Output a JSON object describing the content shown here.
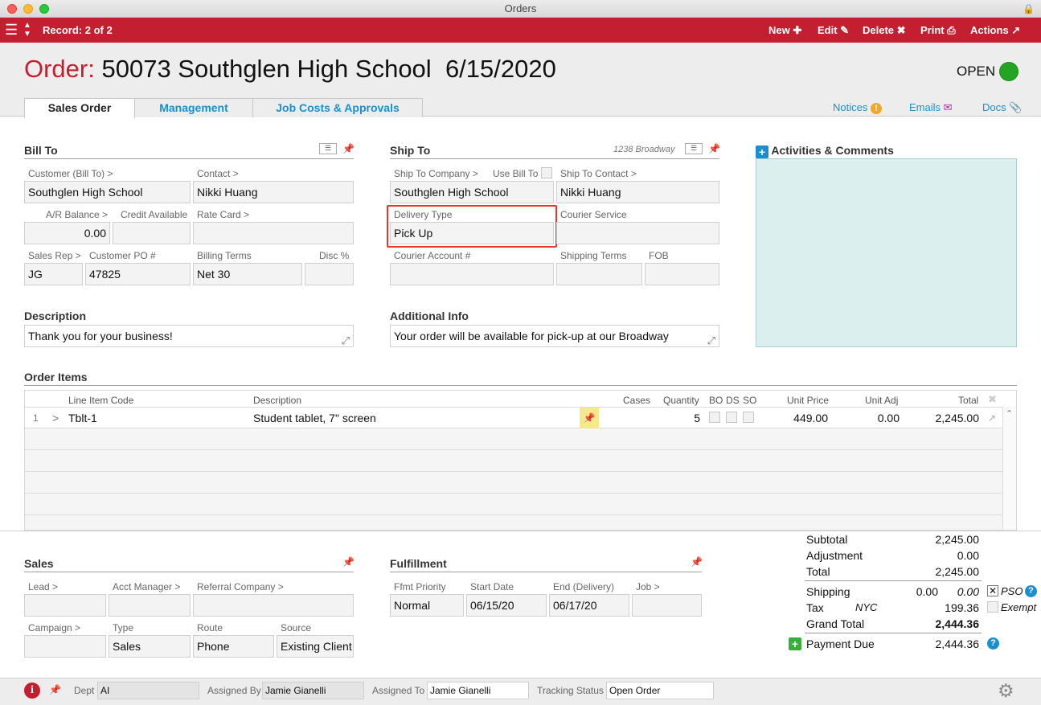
{
  "window": {
    "title": "Orders"
  },
  "toolbar": {
    "record_label": "Record: 2 of 2",
    "new_label": "New",
    "edit_label": "Edit",
    "delete_label": "Delete",
    "print_label": "Print",
    "actions_label": "Actions"
  },
  "order": {
    "label": "Order:",
    "number_name": "50073 Southglen High School",
    "date": "6/15/2020",
    "status": "OPEN",
    "status_color": "#23a423"
  },
  "tabs": [
    {
      "label": "Sales Order"
    },
    {
      "label": "Management"
    },
    {
      "label": "Job Costs & Approvals"
    }
  ],
  "header_links": {
    "notices": "Notices",
    "emails": "Emails",
    "docs": "Docs"
  },
  "bill_to": {
    "title": "Bill To",
    "customer_label": "Customer (Bill To) >",
    "customer": "Southglen High School",
    "contact_label": "Contact >",
    "contact": "Nikki Huang",
    "ar_balance_label": "A/R Balance >",
    "ar_balance": "0.00",
    "credit_available_label": "Credit Available",
    "credit_available": "",
    "rate_card_label": "Rate Card >",
    "rate_card": "",
    "sales_rep_label": "Sales Rep >",
    "sales_rep": "JG",
    "customer_po_label": "Customer PO #",
    "customer_po": "47825",
    "billing_terms_label": "Billing Terms",
    "billing_terms": "Net 30",
    "disc_label": "Disc %",
    "disc": ""
  },
  "ship_to": {
    "title": "Ship To",
    "address_hint": "1238 Broadway",
    "company_label": "Ship To Company >",
    "company": "Southglen High School",
    "use_bill_to_label": "Use Bill To",
    "contact_label": "Ship To Contact >",
    "contact": "Nikki Huang",
    "delivery_type_label": "Delivery Type",
    "delivery_type": "Pick Up",
    "courier_service_label": "Courier Service",
    "courier_service": "",
    "courier_account_label": "Courier Account #",
    "courier_account": "",
    "shipping_terms_label": "Shipping Terms",
    "shipping_terms": "",
    "fob_label": "FOB",
    "fob": ""
  },
  "activities": {
    "title": "Activities & Comments"
  },
  "description": {
    "title": "Description",
    "value": "Thank you for your business!"
  },
  "additional_info": {
    "title": "Additional Info",
    "value": "Your order will be available for pick-up at our Broadway"
  },
  "order_items": {
    "title": "Order Items",
    "columns": {
      "code": "Line Item Code",
      "description": "Description",
      "cases": "Cases",
      "quantity": "Quantity",
      "bo": "BO",
      "ds": "DS",
      "so": "SO",
      "unit_price": "Unit Price",
      "unit_adj": "Unit Adj",
      "total": "Total"
    },
    "rows": [
      {
        "num": "1",
        "arrow": ">",
        "code": "Tblt-1",
        "description": "Student tablet, 7\" screen",
        "cases": "",
        "quantity": "5",
        "unit_price": "449.00",
        "unit_adj": "0.00",
        "total": "2,245.00"
      }
    ]
  },
  "sales": {
    "title": "Sales",
    "lead_label": "Lead >",
    "lead": "",
    "acct_manager_label": "Acct Manager >",
    "acct_manager": "",
    "referral_company_label": "Referral Company >",
    "referral_company": "",
    "campaign_label": "Campaign >",
    "campaign": "",
    "type_label": "Type",
    "type": "Sales",
    "route_label": "Route",
    "route": "Phone",
    "source_label": "Source",
    "source": "Existing Client"
  },
  "fulfillment": {
    "title": "Fulfillment",
    "priority_label": "Ffmt Priority",
    "priority": "Normal",
    "start_date_label": "Start Date",
    "start_date": "06/15/20",
    "end_date_label": "End (Delivery)",
    "end_date": "06/17/20",
    "job_label": "Job >",
    "job": ""
  },
  "totals": {
    "subtotal_label": "Subtotal",
    "subtotal": "2,245.00",
    "adjustment_label": "Adjustment",
    "adjustment": "0.00",
    "total_label": "Total",
    "total": "2,245.00",
    "shipping_label": "Shipping",
    "shipping": "0.00",
    "shipping_italic": "0.00",
    "pso_label": "PSO",
    "tax_label": "Tax",
    "tax_code": "NYC",
    "tax": "199.36",
    "exempt_label": "Exempt",
    "grand_total_label": "Grand Total",
    "grand_total": "2,444.36",
    "payment_due_label": "Payment Due",
    "payment_due": "2,444.36"
  },
  "status_bar": {
    "dept_label": "Dept",
    "dept": "AI",
    "assigned_by_label": "Assigned By",
    "assigned_by": "Jamie Gianelli",
    "assigned_to_label": "Assigned To",
    "assigned_to": "Jamie Gianelli",
    "tracking_status_label": "Tracking Status",
    "tracking_status": "Open Order"
  },
  "colors": {
    "brand": "#c41f31",
    "link": "#1a8fcf",
    "activities_bg": "#dcefef",
    "highlight": "#e8342c"
  }
}
